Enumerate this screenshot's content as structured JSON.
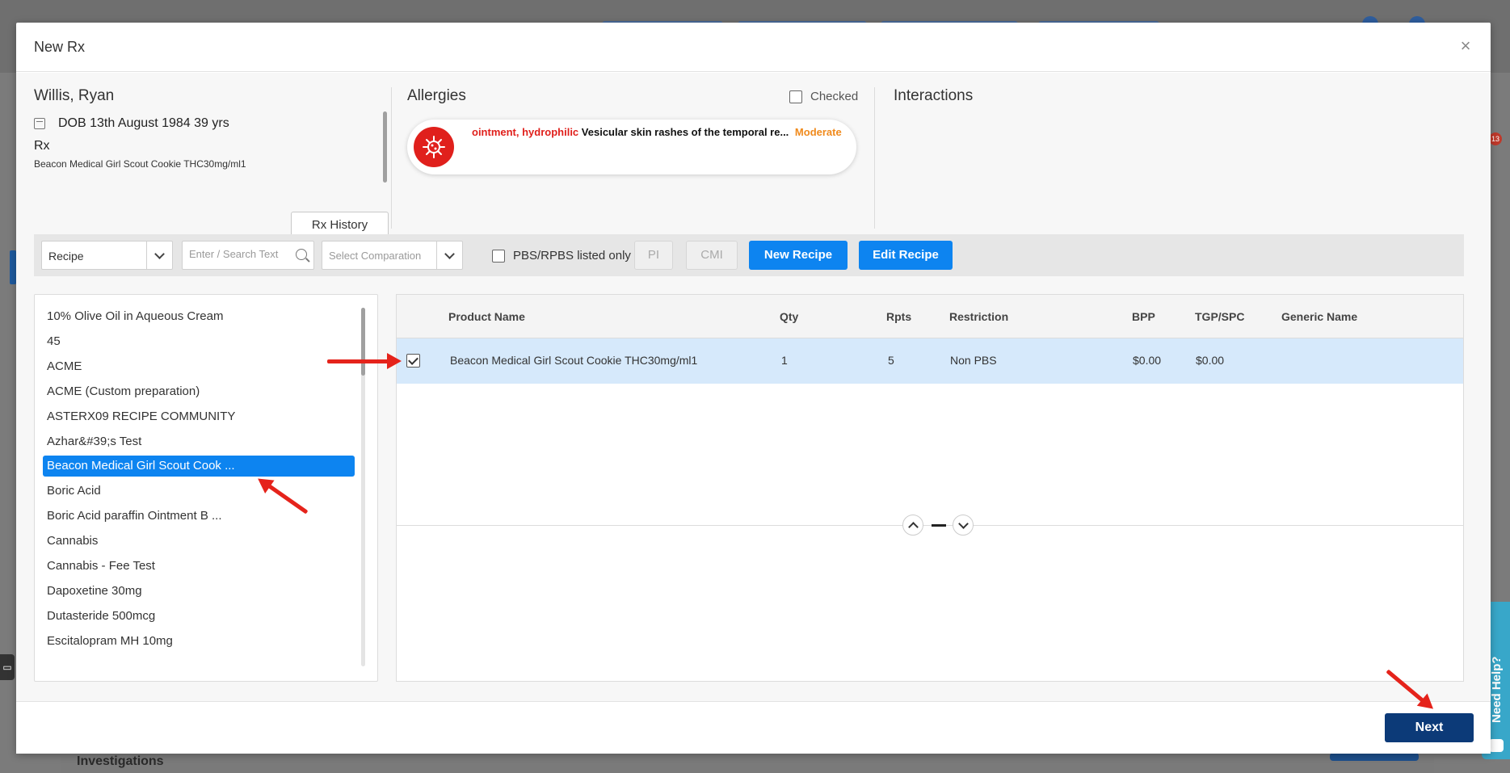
{
  "modal": {
    "title": "New Rx",
    "close_symbol": "×"
  },
  "patient": {
    "name": "Willis, Ryan",
    "dob": "DOB 13th August 1984 39 yrs",
    "rx_label": "Rx",
    "rx_med": "Beacon Medical Girl Scout Cookie THC30mg/ml1",
    "rx_history_label": "Rx History"
  },
  "allergies": {
    "title": "Allergies",
    "checked_label": "Checked",
    "item": {
      "substance": "ointment, hydrophilic",
      "reaction": "Vesicular skin rashes of the temporal re...",
      "severity": "Moderate"
    }
  },
  "interactions": {
    "title": "Interactions"
  },
  "filters": {
    "type_select": "Recipe",
    "search_placeholder": "Enter / Search Text",
    "comparison_placeholder": "Select Comparation",
    "pbs_label": "PBS/RPBS listed only",
    "pi_label": "PI",
    "cmi_label": "CMI",
    "new_recipe_label": "New Recipe",
    "edit_recipe_label": "Edit Recipe"
  },
  "recipes": [
    {
      "label": "10% Olive Oil in Aqueous Cream"
    },
    {
      "label": "45"
    },
    {
      "label": "ACME"
    },
    {
      "label": "ACME (Custom preparation)"
    },
    {
      "label": "ASTERX09 RECIPE COMMUNITY"
    },
    {
      "label": "Azhar&#39;s Test"
    },
    {
      "label": "Beacon Medical Girl Scout Cook ..."
    },
    {
      "label": "Boric Acid"
    },
    {
      "label": "Boric Acid paraffin Ointment B ..."
    },
    {
      "label": "Cannabis"
    },
    {
      "label": "Cannabis - Fee Test"
    },
    {
      "label": "Dapoxetine 30mg"
    },
    {
      "label": "Dutasteride 500mcg"
    },
    {
      "label": "Escitalopram MH 10mg"
    }
  ],
  "selected_recipe_index": 6,
  "product_table": {
    "columns": [
      "Product Name",
      "Qty",
      "Rpts",
      "Restriction",
      "BPP",
      "TGP/SPC",
      "Generic Name"
    ],
    "rows": [
      {
        "checked": true,
        "product_name": "Beacon Medical Girl Scout Cookie THC30mg/ml1",
        "qty": "1",
        "rpts": "5",
        "restriction": "Non PBS",
        "bpp": "$0.00",
        "tgp_spc": "$0.00",
        "generic_name": ""
      }
    ]
  },
  "footer": {
    "next_label": "Next"
  },
  "background": {
    "investigations_label": "Investigations",
    "notification_count": "13",
    "help_label": "Need Help?"
  },
  "colors": {
    "primary": "#0d84f0",
    "next_button": "#0c3a78",
    "allergy_red": "#e0201c",
    "severity_orange": "#f08a1c",
    "selected_row": "#d6e9fb",
    "annotation_arrow": "#e5231b"
  }
}
